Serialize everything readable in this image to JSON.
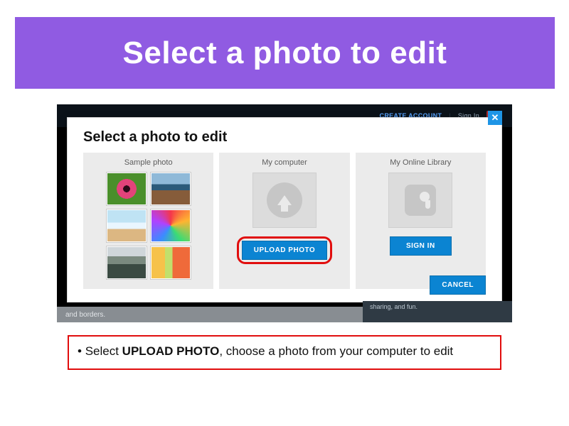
{
  "slide": {
    "title": "Select a photo to edit"
  },
  "screenshot": {
    "header": {
      "create_link": "CREATE ACCOUNT",
      "separator": "|",
      "signin_link": "Sign In"
    },
    "bottom_left_text": "and borders.",
    "bottom_right_line2": "sharing, and fun."
  },
  "dialog": {
    "title": "Select a photo to edit",
    "close_glyph": "✕",
    "panels": {
      "sample": {
        "title": "Sample photo"
      },
      "upload": {
        "title": "My computer",
        "button": "UPLOAD PHOTO"
      },
      "library": {
        "title": "My Online Library",
        "button": "SIGN IN"
      }
    },
    "cancel": "CANCEL"
  },
  "instruction": {
    "bullet": "•",
    "lead": "Select",
    "strong": "UPLOAD PHOTO",
    "rest": ", choose a photo from your computer to edit"
  }
}
